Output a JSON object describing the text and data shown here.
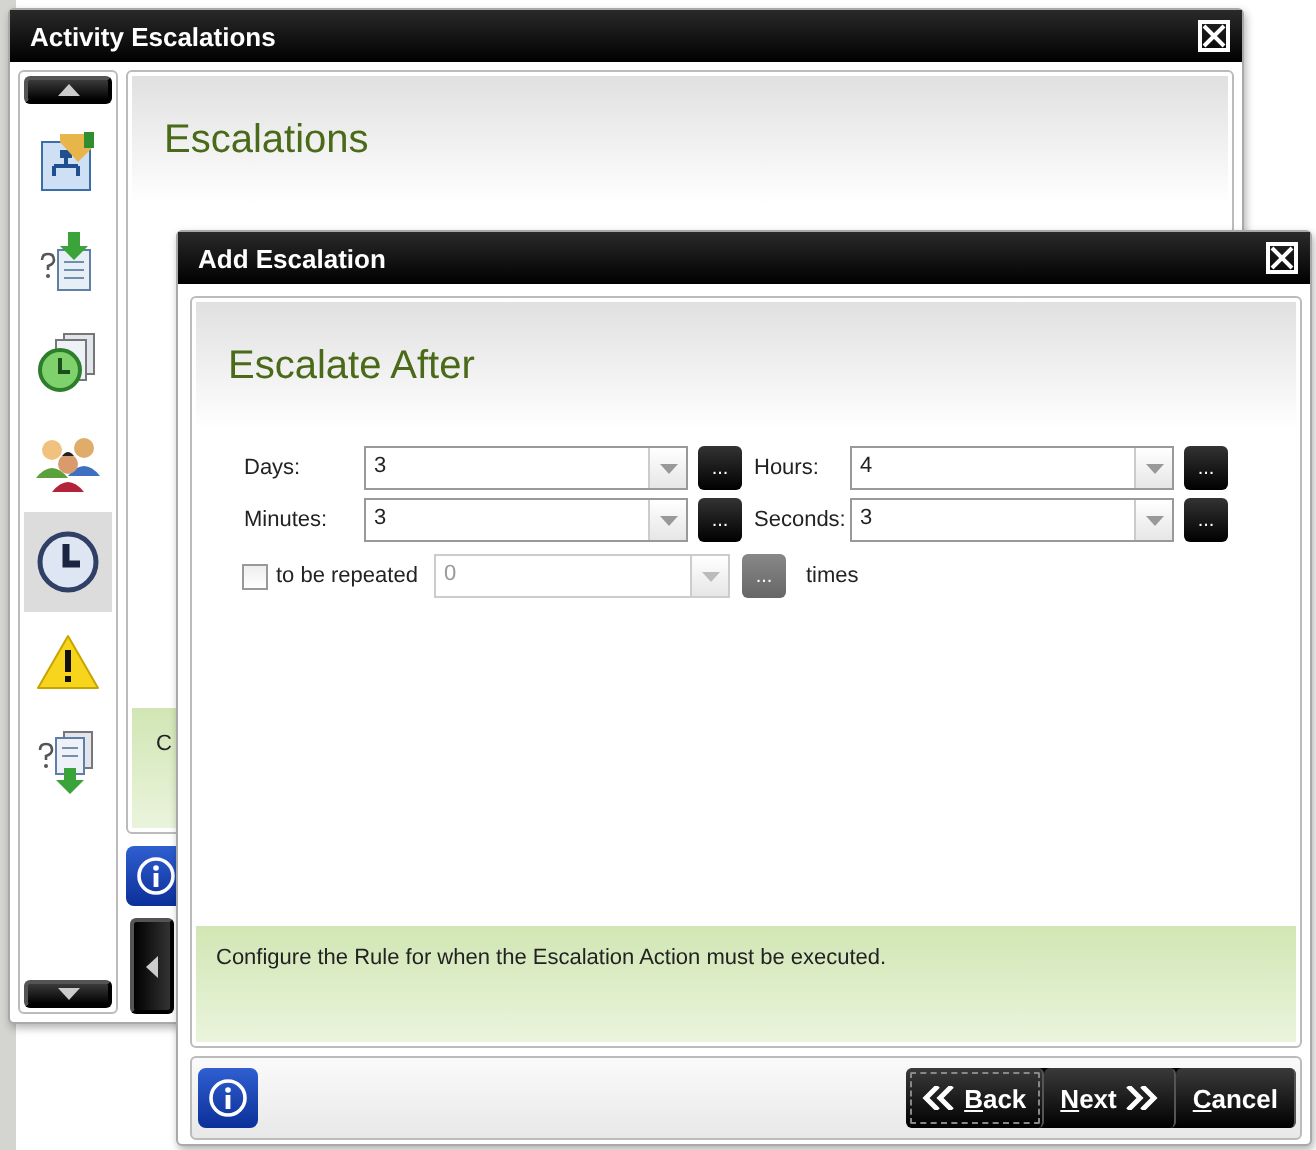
{
  "outer_window": {
    "title": "Activity Escalations",
    "header": "Escalations",
    "info_text": "C"
  },
  "sidebar": {
    "items": [
      {
        "kind": "flowchart",
        "selected": false
      },
      {
        "kind": "doc-in",
        "selected": false
      },
      {
        "kind": "clock-docs",
        "selected": false
      },
      {
        "kind": "people",
        "selected": false
      },
      {
        "kind": "clock",
        "selected": true
      },
      {
        "kind": "warning",
        "selected": false
      },
      {
        "kind": "doc-out",
        "selected": false
      }
    ]
  },
  "dialog": {
    "title": "Add Escalation",
    "header": "Escalate After",
    "fields": [
      {
        "label": "Days:",
        "value": "3",
        "button_label": "..."
      },
      {
        "label": "Hours:",
        "value": "4",
        "button_label": "..."
      },
      {
        "label": "Minutes:",
        "value": "3",
        "button_label": "..."
      },
      {
        "label": "Seconds:",
        "value": "3",
        "button_label": "..."
      }
    ],
    "repeat": {
      "label": "to be repeated",
      "checked": false,
      "value": "0",
      "disabled": true,
      "button_label": "...",
      "suffix": "times"
    },
    "info_text": "Configure the Rule for when the Escalation Action must be executed.",
    "buttons": [
      {
        "kind": "back",
        "label": "Back",
        "focused": true
      },
      {
        "kind": "next",
        "label": "Next",
        "focused": false
      },
      {
        "kind": "cancel",
        "label": "Cancel",
        "focused": false
      }
    ]
  }
}
